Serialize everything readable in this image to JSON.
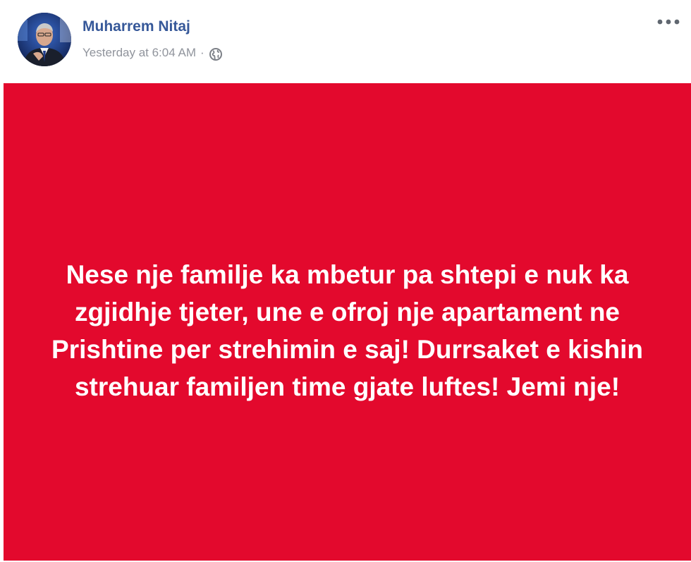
{
  "post": {
    "author": {
      "name": "Muharrem Nitaj",
      "avatar_icon": "profile-photo"
    },
    "meta": {
      "timestamp": "Yesterday at 6:04 AM",
      "separator": "·",
      "audience_icon": "globe-icon"
    },
    "options_icon": "more-dots-icon",
    "status_text": "Nese nje familje ka mbetur pa shtepi e nuk ka zgjidhje tjeter, une e ofroj nje apartament ne Prishtine per strehimin e saj! Durrsaket e kishin strehuar familjen time gjate luftes! Jemi nje!",
    "colors": {
      "background": "#e3092d",
      "text": "#ffffff",
      "author_link": "#365899",
      "meta_text": "#90949c"
    }
  }
}
